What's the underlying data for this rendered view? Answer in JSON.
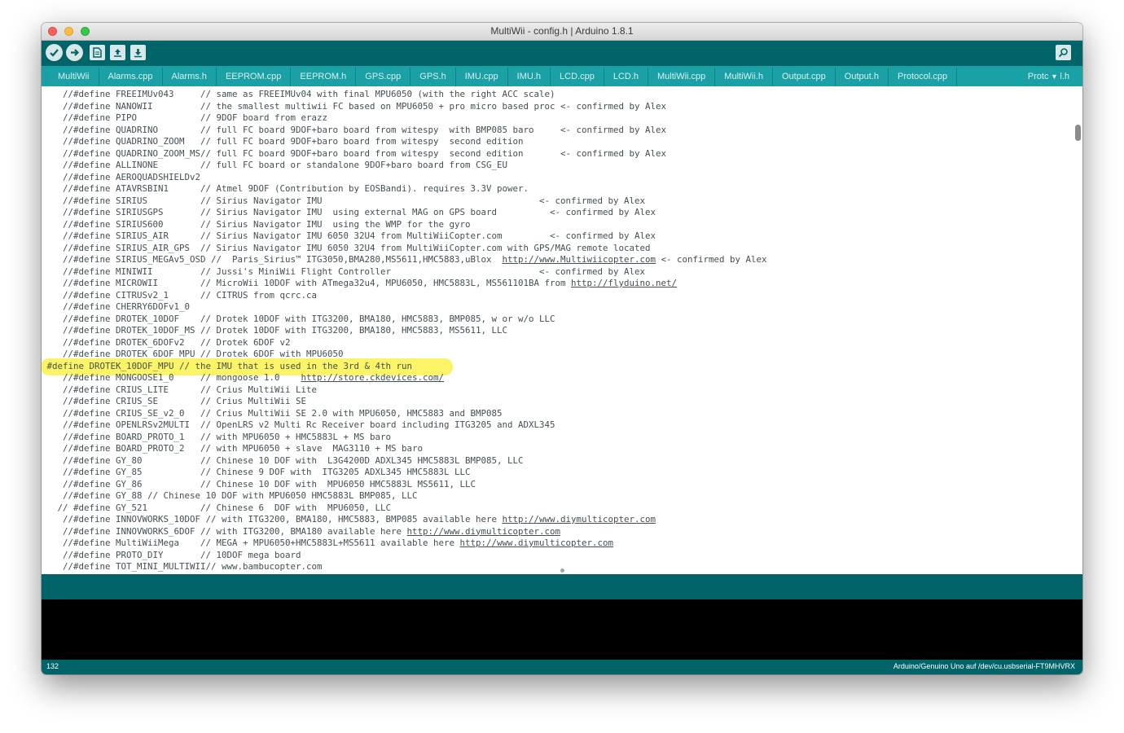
{
  "window": {
    "title": "MultiWii - config.h | Arduino 1.8.1"
  },
  "toolbar": {
    "buttons": [
      "verify-icon",
      "upload-icon",
      "new-icon",
      "open-icon",
      "save-icon",
      "serial-monitor-icon"
    ]
  },
  "tabs": [
    "MultiWii",
    "Alarms.cpp",
    "Alarms.h",
    "EEPROM.cpp",
    "EEPROM.h",
    "GPS.cpp",
    "GPS.h",
    "IMU.cpp",
    "IMU.h",
    "LCD.cpp",
    "LCD.h",
    "MultiWii.cpp",
    "MultiWii.h",
    "Output.cpp",
    "Output.h",
    "Protocol.cpp"
  ],
  "tab_menu": {
    "label": "Protc",
    "suffix": "l.h"
  },
  "code_lines": [
    "    //#define FREEIMUv043     // same as FREEIMUv04 with final MPU6050 (with the right ACC scale)",
    "    //#define NANOWII         // the smallest multiwii FC based on MPU6050 + pro micro based proc <- confirmed by Alex",
    "    //#define PIPO            // 9DOF board from erazz",
    "    //#define QUADRINO        // full FC board 9DOF+baro board from witespy  with BMP085 baro     <- confirmed by Alex",
    "    //#define QUADRINO_ZOOM   // full FC board 9DOF+baro board from witespy  second edition",
    "    //#define QUADRINO_ZOOM_MS// full FC board 9DOF+baro board from witespy  second edition       <- confirmed by Alex",
    "    //#define ALLINONE        // full FC board or standalone 9DOF+baro board from CSG_EU",
    "    //#define AEROQUADSHIELDv2",
    "    //#define ATAVRSBIN1      // Atmel 9DOF (Contribution by EOSBandi). requires 3.3V power.",
    "    //#define SIRIUS          // Sirius Navigator IMU                                         <- confirmed by Alex",
    "    //#define SIRIUSGPS       // Sirius Navigator IMU  using external MAG on GPS board          <- confirmed by Alex",
    "    //#define SIRIUS600       // Sirius Navigator IMU  using the WMP for the gyro",
    "    //#define SIRIUS_AIR      // Sirius Navigator IMU 6050 32U4 from MultiWiiCopter.com         <- confirmed by Alex",
    "    //#define SIRIUS_AIR_GPS  // Sirius Navigator IMU 6050 32U4 from MultiWiiCopter.com with GPS/MAG remote located",
    "    //#define SIRIUS_MEGAv5_OSD //  Paris_Sirius™ ITG3050,BMA280,MS5611,HMC5883,uBlox  http://www.Multiwiicopter.com <- confirmed by Alex",
    "    //#define MINIWII         // Jussi's MiniWii Flight Controller                            <- confirmed by Alex",
    "    //#define MICROWII        // MicroWii 10DOF with ATmega32u4, MPU6050, HMC5883L, MS561101BA from http://flyduino.net/",
    "    //#define CITRUSv2_1      // CITRUS from qcrc.ca",
    "    //#define CHERRY6DOFv1_0",
    "    //#define DROTEK_10DOF    // Drotek 10DOF with ITG3200, BMA180, HMC5883, BMP085, w or w/o LLC",
    "    //#define DROTEK_10DOF_MS // Drotek 10DOF with ITG3200, BMA180, HMC5883, MS5611, LLC",
    "    //#define DROTEK_6DOFv2   // Drotek 6DOF v2",
    "    //#define DROTEK_6DOF_MPU // Drotek 6DOF with MPU6050",
    " #define DROTEK_10DOF_MPU // the IMU that is used in the 3rd & 4th run",
    "    //#define MONGOOSE1_0     // mongoose 1.0    http://store.ckdevices.com/",
    "    //#define CRIUS_LITE      // Crius MultiWii Lite",
    "    //#define CRIUS_SE        // Crius MultiWii SE",
    "    //#define CRIUS_SE_v2_0   // Crius MultiWii SE 2.0 with MPU6050, HMC5883 and BMP085",
    "    //#define OPENLRSv2MULTI  // OpenLRS v2 Multi Rc Receiver board including ITG3205 and ADXL345",
    "    //#define BOARD_PROTO_1   // with MPU6050 + HMC5883L + MS baro",
    "    //#define BOARD_PROTO_2   // with MPU6050 + slave  MAG3110 + MS baro",
    "    //#define GY_80           // Chinese 10 DOF with  L3G4200D ADXL345 HMC5883L BMP085, LLC",
    "    //#define GY_85           // Chinese 9 DOF with  ITG3205 ADXL345 HMC5883L LLC",
    "    //#define GY_86           // Chinese 10 DOF with  MPU6050 HMC5883L MS5611, LLC",
    "    //#define GY_88 // Chinese 10 DOF with MPU6050 HMC5883L BMP085, LLC",
    "   // #define GY_521          // Chinese 6  DOF with  MPU6050, LLC",
    "    //#define INNOVWORKS_10DOF // with ITG3200, BMA180, HMC5883, BMP085 available here http://www.diymulticopter.com",
    "    //#define INNOVWORKS_6DOF // with ITG3200, BMA180 available here http://www.diymulticopter.com",
    "    //#define MultiWiiMega    // MEGA + MPU6050+HMC5883L+MS5611 available here http://www.diymulticopter.com",
    "    //#define PROTO_DIY       // 10DOF mega board",
    "    //#define TOT_MINI_MULTIWII// www.bambucopter.com"
  ],
  "highlight_line_index": 23,
  "status": {
    "line_number": "132",
    "board": "Arduino/Genuino Uno auf /dev/cu.usbserial-FT9MHVRX"
  }
}
